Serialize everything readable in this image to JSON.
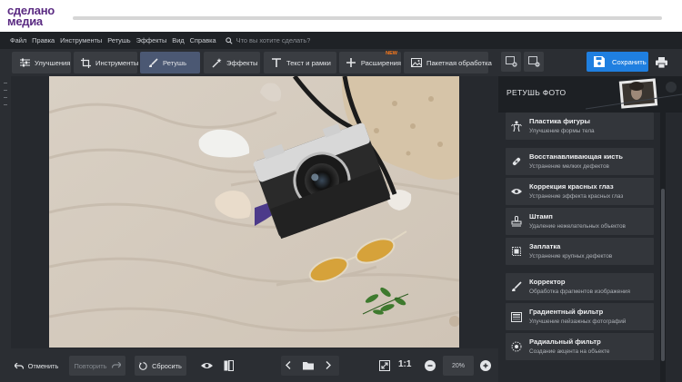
{
  "banner": {
    "logo_line1": "сделано",
    "logo_line2": "медиа"
  },
  "menu": {
    "items": [
      "Файл",
      "Правка",
      "Инструменты",
      "Ретушь",
      "Эффекты",
      "Вид",
      "Справка"
    ],
    "search_placeholder": "Что вы хотите сделать?"
  },
  "toolbar": {
    "tabs": [
      {
        "label": "Улучшения",
        "icon": "sliders-icon"
      },
      {
        "label": "Инструменты",
        "icon": "crop-icon"
      },
      {
        "label": "Ретушь",
        "icon": "brush-icon",
        "active": true
      },
      {
        "label": "Эффекты",
        "icon": "magic-wand-icon"
      },
      {
        "label": "Текст и рамки",
        "icon": "text-icon"
      },
      {
        "label": "Расширения",
        "icon": "plus-icon",
        "badge": "NEW"
      },
      {
        "label": "Пакетная обработка",
        "icon": "batch-icon"
      }
    ],
    "save_label": "Сохранить"
  },
  "bottom": {
    "undo_label": "Отменить",
    "redo_label": "Повторить",
    "reset_label": "Сбросить",
    "ratio_label": "1:1",
    "zoom_value": "20%"
  },
  "panel": {
    "title": "РЕТУШЬ ФОТО",
    "groups": [
      [
        {
          "title": "Пластика фигуры",
          "subtitle": "Улучшение формы тела",
          "icon": "body-icon"
        }
      ],
      [
        {
          "title": "Восстанавливающая кисть",
          "subtitle": "Устранение мелких дефектов",
          "icon": "healing-brush-icon"
        },
        {
          "title": "Коррекция красных глаз",
          "subtitle": "Устранение эффекта красных глаз",
          "icon": "eye-icon"
        },
        {
          "title": "Штамп",
          "subtitle": "Удаление нежелательных объектов",
          "icon": "stamp-icon"
        },
        {
          "title": "Заплатка",
          "subtitle": "Устранение крупных дефектов",
          "icon": "patch-icon"
        }
      ],
      [
        {
          "title": "Корректор",
          "subtitle": "Обработка фрагментов изображения",
          "icon": "corrector-brush-icon"
        },
        {
          "title": "Градиентный фильтр",
          "subtitle": "Улучшение пейзажных фотографий",
          "icon": "gradient-icon"
        },
        {
          "title": "Радиальный фильтр",
          "subtitle": "Создание акцента на объекте",
          "icon": "radial-icon"
        }
      ]
    ]
  },
  "colors": {
    "accent": "#1f7fe0",
    "active_tab": "#4b5873",
    "badge": "#ff7a1a",
    "logo": "#5a2a82"
  }
}
